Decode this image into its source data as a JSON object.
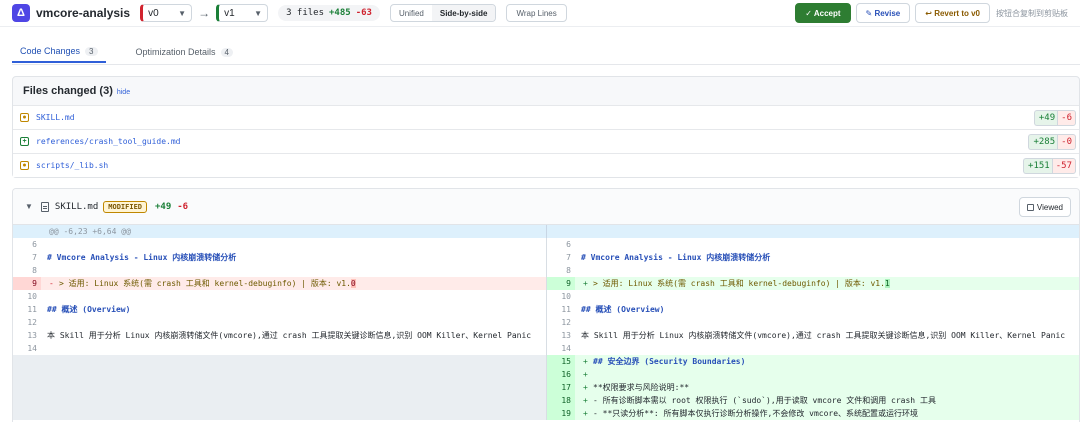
{
  "app": {
    "logo": "Δ",
    "title": "vmcore-analysis"
  },
  "versions": {
    "from": "v0",
    "arrow": "→",
    "to": "v1"
  },
  "stats": {
    "files": "3 files",
    "additions": "+485",
    "deletions": "-63"
  },
  "view_modes": [
    "Unified",
    "Side-by-side"
  ],
  "active_view": "Side-by-side",
  "wrap_label": "Wrap Lines",
  "actions": {
    "accept": "✓ Accept",
    "revise": "✎ Revise",
    "revert": "↩ Revert to v0",
    "hint": "按钮合复制到剪贴板"
  },
  "tabs": [
    {
      "label": "Code Changes",
      "count": "3"
    },
    {
      "label": "Optimization Details",
      "count": "4"
    }
  ],
  "files_changed": {
    "title": "Files changed (3)",
    "hide": "hide",
    "files": [
      {
        "name": "SKILL.md",
        "icon": "modified-file-icon",
        "glyph": "●",
        "additions": "+49",
        "deletions": "-6"
      },
      {
        "name": "references/crash_tool_guide.md",
        "icon": "added-file-icon",
        "glyph": "+",
        "additions": "+285",
        "deletions": "-0"
      },
      {
        "name": "scripts/_lib.sh",
        "icon": "modified-file-icon",
        "glyph": "●",
        "additions": "+151",
        "deletions": "-57"
      }
    ]
  },
  "diff": {
    "collapse": "▼",
    "file": "SKILL.md",
    "badge": "MODIFIED",
    "additions": "+49",
    "deletions": "-6",
    "viewed": "Viewed",
    "hunk": "@@ -6,23 +6,64 @@",
    "rows": [
      {
        "type": "ctx",
        "l_num": "6",
        "r_num": "6",
        "text": ""
      },
      {
        "type": "ctx",
        "l_num": "7",
        "r_num": "7",
        "text": "# Vmcore Analysis - Linux 内核崩溃转储分析",
        "style": "head"
      },
      {
        "type": "ctx",
        "l_num": "8",
        "r_num": "8",
        "text": ""
      },
      {
        "type": "change",
        "l_num": "9",
        "r_num": "9",
        "l_text": "> 适用: Linux 系统(需 crash 工具和 kernel-debuginfo) | 版本: v1.",
        "l_hl": "0",
        "r_text": "> 适用: Linux 系统(需 crash 工具和 kernel-debuginfo) | 版本: v1.",
        "r_hl": "1"
      },
      {
        "type": "ctx",
        "l_num": "10",
        "r_num": "10",
        "text": ""
      },
      {
        "type": "ctx",
        "l_num": "11",
        "r_num": "11",
        "text": "## 概述 (Overview)",
        "style": "head"
      },
      {
        "type": "ctx",
        "l_num": "12",
        "r_num": "12",
        "text": ""
      },
      {
        "type": "ctx",
        "l_num": "13",
        "r_num": "13",
        "text": "本 Skill 用于分析 Linux 内核崩溃转储文件(vmcore),通过 crash 工具提取关键诊断信息,识别 OOM Killer、Kernel Panic"
      },
      {
        "type": "ctx",
        "l_num": "14",
        "r_num": "14",
        "text": ""
      },
      {
        "type": "add",
        "r_num": "15",
        "text": "## 安全边界 (Security Boundaries)",
        "style": "head"
      },
      {
        "type": "add",
        "r_num": "16",
        "text": ""
      },
      {
        "type": "add",
        "r_num": "17",
        "text": "**权限要求与风险说明:**"
      },
      {
        "type": "add",
        "r_num": "18",
        "text": "- 所有诊断脚本需以 root 权限执行 (`sudo`),用于读取 vmcore 文件和调用 crash 工具"
      },
      {
        "type": "add",
        "r_num": "19",
        "text": "- **只读分析**: 所有脚本仅执行诊断分析操作,不会修改 vmcore、系统配置或运行环境"
      }
    ]
  }
}
